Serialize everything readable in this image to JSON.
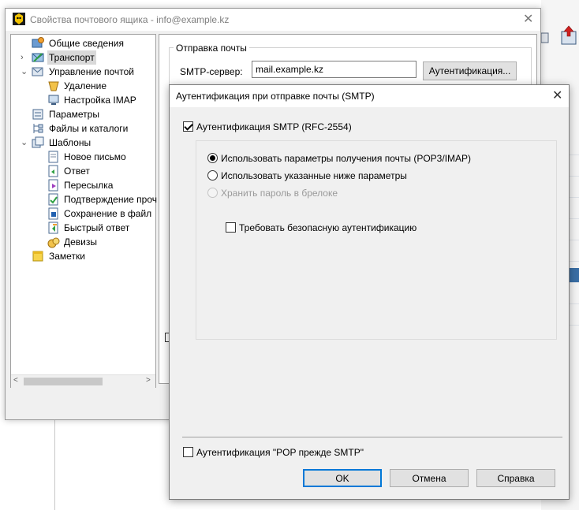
{
  "back_window": {
    "title": "Свойства почтового ящика - info@example.kz",
    "tree": [
      {
        "label": "Общие сведения",
        "icon": "mailbox-info-icon"
      },
      {
        "label": "Транспорт",
        "icon": "transport-icon"
      },
      {
        "label": "Управление почтой",
        "icon": "mail-management-icon"
      },
      {
        "label": "Удаление",
        "icon": "trash-icon"
      },
      {
        "label": "Настройка IMAP",
        "icon": "imap-settings-icon"
      },
      {
        "label": "Параметры",
        "icon": "parameters-icon"
      },
      {
        "label": "Файлы и каталоги",
        "icon": "files-folders-icon"
      },
      {
        "label": "Шаблоны",
        "icon": "templates-icon"
      },
      {
        "label": "Новое письмо",
        "icon": "template-new-message-icon"
      },
      {
        "label": "Ответ",
        "icon": "template-reply-icon"
      },
      {
        "label": "Пересылка",
        "icon": "template-forward-icon"
      },
      {
        "label": "Подтверждение проч",
        "icon": "template-read-receipt-icon"
      },
      {
        "label": "Сохранение в файл",
        "icon": "template-save-file-icon"
      },
      {
        "label": "Быстрый ответ",
        "icon": "template-quick-reply-icon"
      },
      {
        "label": "Девизы",
        "icon": "mottos-icon"
      },
      {
        "label": "Заметки",
        "icon": "notes-icon"
      }
    ],
    "send_group_title": "Отправка почты",
    "smtp_label": "SMTP-сервер:",
    "smtp_value": "mail.example.kz",
    "auth_button": "Аутентификация..."
  },
  "dialog": {
    "title": "Аутентификация при отправке почты (SMTP)",
    "smtp_auth_checkbox": {
      "label": "Аутентификация SMTP (RFC-2554)",
      "checked": true
    },
    "radio_options": [
      {
        "label": "Использовать параметры получения почты (POP3/IMAP)",
        "checked": true,
        "disabled": false
      },
      {
        "label": "Использовать указанные ниже параметры",
        "checked": false,
        "disabled": false
      },
      {
        "label": "Хранить пароль в брелоке",
        "checked": false,
        "disabled": true
      }
    ],
    "secure_auth_checkbox": {
      "label": "Требовать безопасную аутентификацию",
      "checked": false
    },
    "pop_before_smtp_checkbox": {
      "label": "Аутентификация \"POP прежде SMTP\"",
      "checked": false
    },
    "buttons": {
      "ok": "OK",
      "cancel": "Отмена",
      "help": "Справка"
    }
  }
}
